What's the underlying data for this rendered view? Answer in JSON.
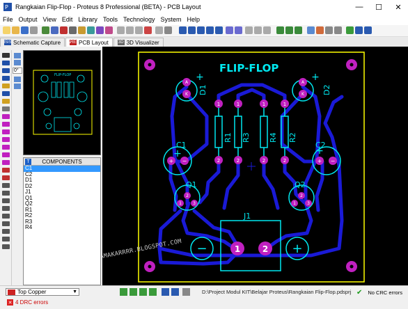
{
  "window": {
    "title": "Rangkaian Flip-Flop - Proteus 8 Professional (BETA) - PCB Layout",
    "controls": [
      "—",
      "☐",
      "✕"
    ]
  },
  "menu": [
    "File",
    "Output",
    "View",
    "Edit",
    "Library",
    "Tools",
    "Technology",
    "System",
    "Help"
  ],
  "tabs": [
    {
      "label": "Schematic Capture",
      "icon": "ISIS"
    },
    {
      "label": "PCB Layout",
      "icon": "ARES"
    },
    {
      "label": "3D Visualizer",
      "icon": "3D"
    }
  ],
  "side": {
    "rotation_value": "0°",
    "components_title": "COMPONENTS",
    "components_btn": "T",
    "components": [
      "C1",
      "C2",
      "D1",
      "D2",
      "J1",
      "Q1",
      "Q2",
      "R1",
      "R2",
      "R3",
      "R4"
    ],
    "selected_index": 0
  },
  "pcb": {
    "title": "FLIP-FLOP",
    "watermark": "MEKATRONIKA-PAMAKARRRR.BLOGSPOT.COM",
    "labels": {
      "D1": "D1",
      "D2": "D2",
      "C1": "C1",
      "C2": "C2",
      "R1": "R1",
      "R2": "R2",
      "R3": "R3",
      "R4": "R4",
      "Q1": "Q1",
      "Q2": "Q2",
      "J1": "J1"
    },
    "pad_text": {
      "A": "A",
      "K": "K",
      "one": "1",
      "two": "2",
      "three": "3",
      "plus": "+",
      "minus": "−"
    },
    "preview_title": "FLIP-FLOP"
  },
  "colors": {
    "board_outline": "#ffff00",
    "trace": "#1a1ad6",
    "pad": "#c020c0",
    "silk": "#00e8f0",
    "canvas_bg": "#000000"
  },
  "status": {
    "layer": "Top Copper",
    "drc_errors": "4 DRC errors",
    "project_path": "D:\\Project Modul KIT\\Belajar Proteus\\Rangkaian Flip-Flop.pdsprj",
    "crc": "No CRC errors"
  }
}
